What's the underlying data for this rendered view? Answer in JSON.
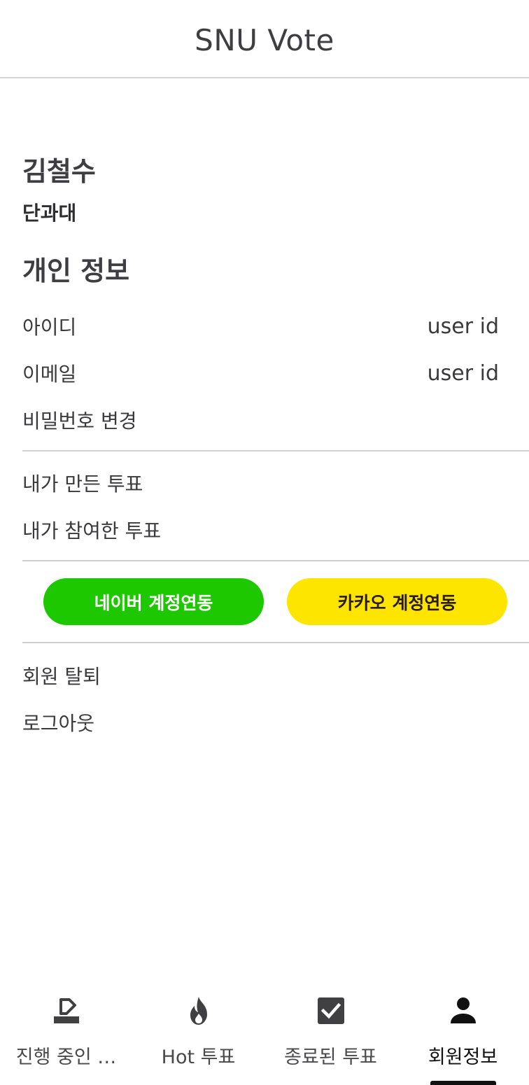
{
  "header": {
    "title": "SNU Vote"
  },
  "profile": {
    "name": "김철수",
    "department": "단과대"
  },
  "personal_info": {
    "title": "개인 정보",
    "id_label": "아이디",
    "id_value": "user id",
    "email_label": "이메일",
    "email_value": "user id",
    "change_password": "비밀번호 변경"
  },
  "my_votes": {
    "created": "내가 만든 투표",
    "participated": "내가 참여한 투표"
  },
  "social": {
    "naver_label": "네이버 계정연동",
    "naver_color": "#1ec800",
    "kakao_label": "카카오 계정연동",
    "kakao_color": "#fee500"
  },
  "account": {
    "withdraw": "회원 탈퇴",
    "logout": "로그아웃"
  },
  "bottom_nav": {
    "items": [
      {
        "label": "진행 중인 …",
        "icon": "ballot-box-icon",
        "active": false
      },
      {
        "label": "Hot 투표",
        "icon": "fire-icon",
        "active": false
      },
      {
        "label": "종료된 투표",
        "icon": "checkbox-icon",
        "active": false
      },
      {
        "label": "회원정보",
        "icon": "person-icon",
        "active": true
      }
    ]
  }
}
